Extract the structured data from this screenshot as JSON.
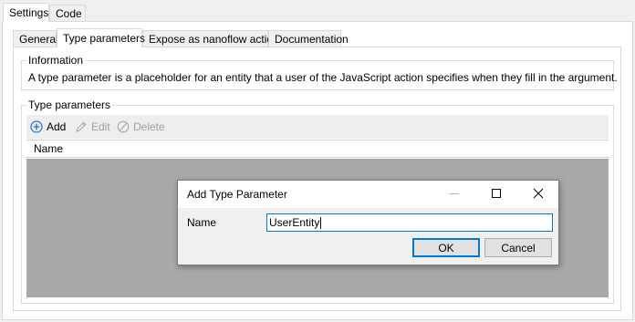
{
  "outer_tabs": [
    {
      "label": "Settings",
      "active": true
    },
    {
      "label": "Code",
      "active": false
    }
  ],
  "inner_tabs": [
    {
      "label": "General",
      "active": false
    },
    {
      "label": "Type parameters",
      "active": true
    },
    {
      "label": "Expose as nanoflow action",
      "active": false
    },
    {
      "label": "Documentation",
      "active": false
    }
  ],
  "information": {
    "legend": "Information",
    "text": "A type parameter is a placeholder for an entity that a user of the JavaScript action specifies when they fill in the argument."
  },
  "type_parameters": {
    "legend": "Type parameters",
    "toolbar": {
      "add": {
        "label": "Add",
        "icon": "plus-circle-icon",
        "enabled": true
      },
      "edit": {
        "label": "Edit",
        "icon": "pencil-icon",
        "enabled": false
      },
      "delete": {
        "label": "Delete",
        "icon": "no-entry-icon",
        "enabled": false
      }
    },
    "columns": [
      "Name"
    ],
    "rows": []
  },
  "dialog": {
    "title": "Add Type Parameter",
    "name_label": "Name",
    "name_value": "UserEntity",
    "ok_label": "OK",
    "cancel_label": "Cancel"
  },
  "colors": {
    "focus_blue": "#0078d7",
    "add_icon_blue": "#1e6fd9",
    "grid_body": "#a9a9a9"
  }
}
